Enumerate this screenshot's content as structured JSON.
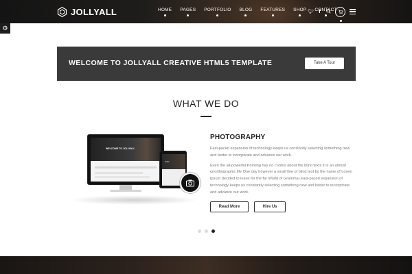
{
  "header": {
    "logo_text": "JOLLYALL",
    "nav": [
      {
        "label": "HOME"
      },
      {
        "label": "PAGES"
      },
      {
        "label": "PORTFOLIO"
      },
      {
        "label": "BLOG"
      },
      {
        "label": "FEATURES"
      },
      {
        "label": "SHOP"
      },
      {
        "label": "CONTACT"
      }
    ],
    "icons": {
      "twitter": "twitter-icon",
      "facebook": "facebook-icon",
      "search": "search-icon",
      "cart": "cart-icon",
      "menu": "menu-icon"
    }
  },
  "settings": {
    "icon": "gear-icon"
  },
  "banner": {
    "title": "WELCOME TO JOLLYALL CREATIVE HTML5 TEMPLATE",
    "button_label": "Take A Tour"
  },
  "section": {
    "title": "WHAT WE DO"
  },
  "mockup": {
    "screen_title": "WELCOME TO JOLLYALL",
    "tablet_text": "JOLL"
  },
  "slide": {
    "title": "PHOTOGRAPHY",
    "paragraph1": "Fast-paced expansion of technology keeps us constantly selecting something new and better to incorporate and advance our work.",
    "paragraph2": "Even the all-powerful Pointing has no control about the blind texts it is an almost unorthographic life One day however a small line of blind text by the name of Lorem Ipsum decided to leave for the far World of Grammar.Fast-paced expansion of technology keeps us constantly selecting something new and better to incorporate and advance our work.",
    "read_more_label": "Read More",
    "hire_us_label": "Hire Us"
  },
  "slider": {
    "total": 3,
    "active_index": 2
  },
  "colors": {
    "header_bg": "#1b1b1b",
    "banner_bg": "#3a3a3a",
    "text_dark": "#222222",
    "text_muted": "#777777"
  }
}
